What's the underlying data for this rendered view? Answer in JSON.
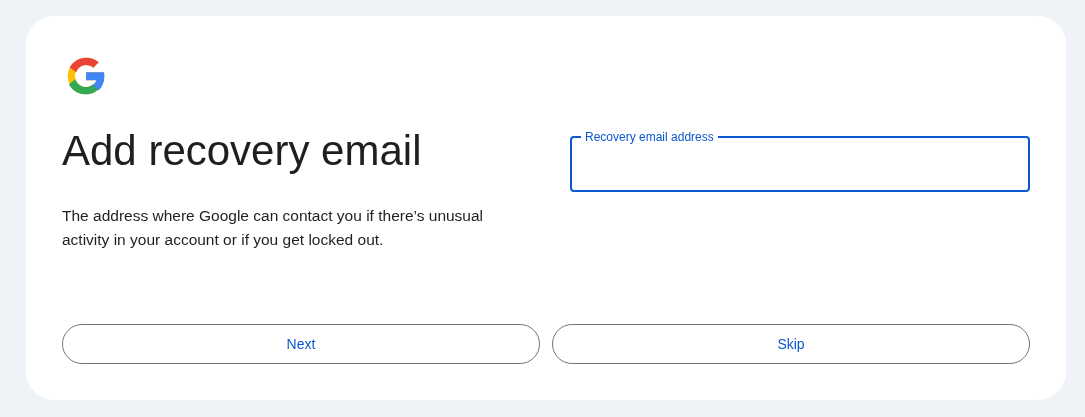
{
  "title": "Add recovery email",
  "description": "The address where Google can contact you if there’s unusual activity in your account or if you get locked out.",
  "field": {
    "label": "Recovery email address",
    "focused": true
  },
  "buttons": [
    {
      "label": "Next"
    },
    {
      "label": "Skip"
    }
  ]
}
